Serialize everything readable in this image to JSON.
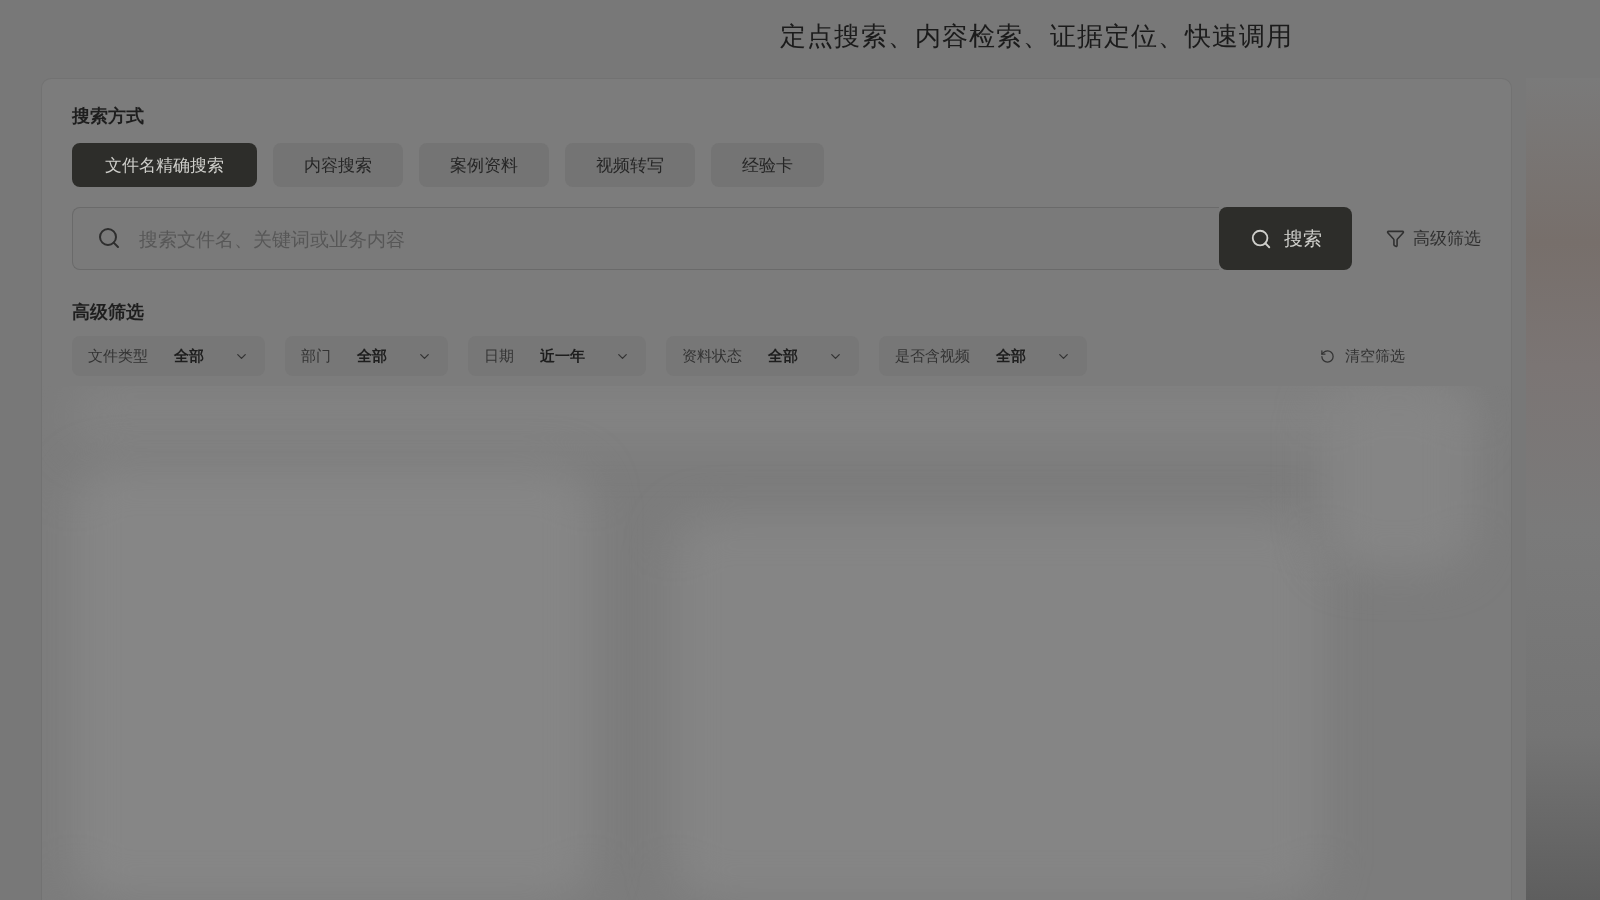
{
  "hero": {
    "subtitle": "定点搜索、内容检索、证据定位、快速调用"
  },
  "search_card": {
    "mode_label": "搜索方式",
    "modes": [
      {
        "label": "文件名精确搜索",
        "selected": true
      },
      {
        "label": "内容搜索",
        "selected": false
      },
      {
        "label": "案例资料",
        "selected": false
      },
      {
        "label": "视频转写",
        "selected": false
      },
      {
        "label": "经验卡",
        "selected": false
      }
    ],
    "search": {
      "placeholder": "搜索文件名、关键词或业务内容",
      "button": "搜索"
    },
    "advanced_link": "高级筛选",
    "filters_title": "高级筛选",
    "filters": [
      {
        "label": "文件类型",
        "value": "全部"
      },
      {
        "label": "部门",
        "value": "全部"
      },
      {
        "label": "日期",
        "value": "近一年"
      },
      {
        "label": "资料状态",
        "value": "全部"
      },
      {
        "label": "是否含视频",
        "value": "全部"
      }
    ],
    "clear_button": "清空筛选"
  }
}
